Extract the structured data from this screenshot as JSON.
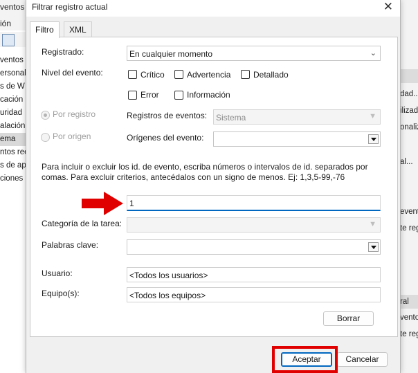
{
  "background": {
    "left_menu": [
      "ventos",
      "ión"
    ],
    "left_menu_v": "V",
    "tree": [
      "ventos (l",
      "ersonal",
      "s de W",
      "cación",
      "uridad",
      "alación",
      "ema",
      "ntos ree",
      "s de ap",
      "ciones"
    ],
    "tree_selected_index": 6,
    "right_items": [
      "dad...",
      "ilizad",
      "onaliz",
      "al...",
      "event",
      "te reg",
      "ral",
      "vento",
      "te reg"
    ]
  },
  "dialog": {
    "title": "Filtrar registro actual",
    "tabs": [
      "Filtro",
      "XML"
    ],
    "registered_label": "Registrado:",
    "registered_value": "En cualquier momento",
    "level_label": "Nivel del evento:",
    "levels": [
      "Crítico",
      "Advertencia",
      "Detallado",
      "Error",
      "Información"
    ],
    "by_log_label": "Por registro",
    "by_source_label": "Por origen",
    "event_logs_label": "Registros de eventos:",
    "event_logs_value": "Sistema",
    "event_sources_label": "Orígenes del evento:",
    "event_sources_value": "",
    "help_text_1": "Para incluir o excluir los id. de evento, escriba números o intervalos de id. separados por",
    "help_text_2": "comas. Para excluir criterios, antecédalos con un signo de menos. Ej: 1,3,5-99,-76",
    "event_id_value": "1",
    "task_category_label": "Categoría de la tarea:",
    "task_category_value": "",
    "keywords_label": "Palabras clave:",
    "keywords_value": "",
    "user_label": "Usuario:",
    "user_value": "<Todos los usuarios>",
    "computer_label": "Equipo(s):",
    "computer_value": "<Todos los equipos>",
    "clear_button": "Borrar",
    "ok_button": "Aceptar",
    "cancel_button": "Cancelar"
  },
  "colors": {
    "annotation_red": "#e00000",
    "focus_blue": "#0067c0"
  }
}
